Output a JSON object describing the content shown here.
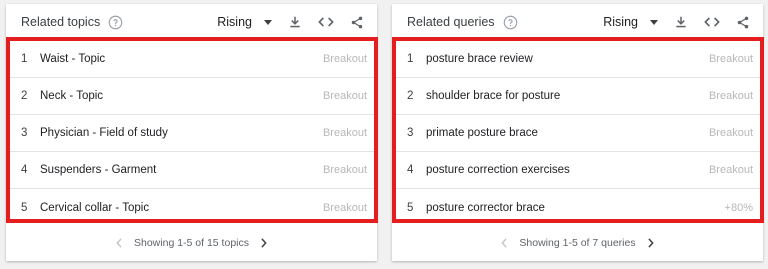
{
  "topics": {
    "title": "Related topics",
    "filter": "Rising",
    "rows": [
      {
        "rank": "1",
        "label": "Waist - Topic",
        "value": "Breakout"
      },
      {
        "rank": "2",
        "label": "Neck - Topic",
        "value": "Breakout"
      },
      {
        "rank": "3",
        "label": "Physician - Field of study",
        "value": "Breakout"
      },
      {
        "rank": "4",
        "label": "Suspenders - Garment",
        "value": "Breakout"
      },
      {
        "rank": "5",
        "label": "Cervical collar - Topic",
        "value": "Breakout"
      }
    ],
    "pagination": "Showing 1-5 of 15 topics"
  },
  "queries": {
    "title": "Related queries",
    "filter": "Rising",
    "rows": [
      {
        "rank": "1",
        "label": "posture brace review",
        "value": "Breakout"
      },
      {
        "rank": "2",
        "label": "shoulder brace for posture",
        "value": "Breakout"
      },
      {
        "rank": "3",
        "label": "primate posture brace",
        "value": "Breakout"
      },
      {
        "rank": "4",
        "label": "posture correction exercises",
        "value": "Breakout"
      },
      {
        "rank": "5",
        "label": "posture corrector brace",
        "value": "+80%"
      }
    ],
    "pagination": "Showing 1-5 of 7 queries"
  },
  "icons": {
    "help": "help-circle-icon",
    "download": "download-icon",
    "embed": "embed-code-icon",
    "share": "share-icon",
    "prev": "chevron-left-icon",
    "next": "chevron-right-icon"
  },
  "colors": {
    "highlight": "#e41e1e",
    "muted_value": "#b8b8b8",
    "background": "#f1f1f1"
  }
}
